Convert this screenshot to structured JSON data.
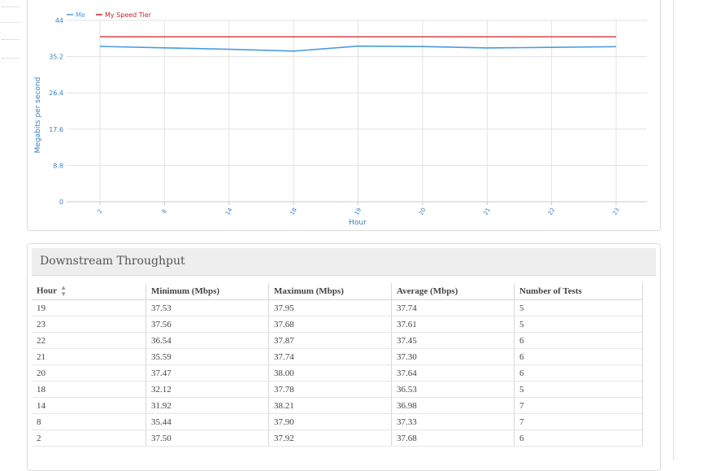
{
  "chart_data": {
    "type": "line",
    "ylabel": "Megabits per second",
    "xlabel": "Hour",
    "categories": [
      "2",
      "8",
      "14",
      "18",
      "19",
      "20",
      "21",
      "22",
      "23"
    ],
    "yticks": [
      0,
      8.8,
      17.6,
      26.4,
      35.2,
      44
    ],
    "ylim": [
      0,
      44
    ],
    "grid": true,
    "legend_position": "top-left",
    "series": [
      {
        "name": "Me",
        "color": "#4a9be0",
        "values": [
          37.68,
          37.33,
          36.98,
          36.53,
          37.74,
          37.64,
          37.3,
          37.45,
          37.61
        ]
      },
      {
        "name": "My Speed Tier",
        "color": "#cc2222",
        "values": [
          40,
          40,
          40,
          40,
          40,
          40,
          40,
          40,
          40
        ]
      }
    ]
  },
  "table_panel": {
    "title": "Downstream Throughput",
    "columns": [
      "Hour",
      "Minimum (Mbps)",
      "Maximum (Mbps)",
      "Average (Mbps)",
      "Number of Tests"
    ],
    "sort_icon": "sort-icon",
    "rows": [
      [
        "19",
        "37.53",
        "37.95",
        "37.74",
        "5"
      ],
      [
        "23",
        "37.56",
        "37.68",
        "37.61",
        "5"
      ],
      [
        "22",
        "36.54",
        "37.87",
        "37.45",
        "6"
      ],
      [
        "21",
        "35.59",
        "37.74",
        "37.30",
        "6"
      ],
      [
        "20",
        "37.47",
        "38.00",
        "37.64",
        "6"
      ],
      [
        "18",
        "32.12",
        "37.78",
        "36.53",
        "5"
      ],
      [
        "14",
        "31.92",
        "38.21",
        "36.98",
        "7"
      ],
      [
        "8",
        "35.44",
        "37.90",
        "37.33",
        "7"
      ],
      [
        "2",
        "37.50",
        "37.92",
        "37.68",
        "6"
      ]
    ]
  }
}
